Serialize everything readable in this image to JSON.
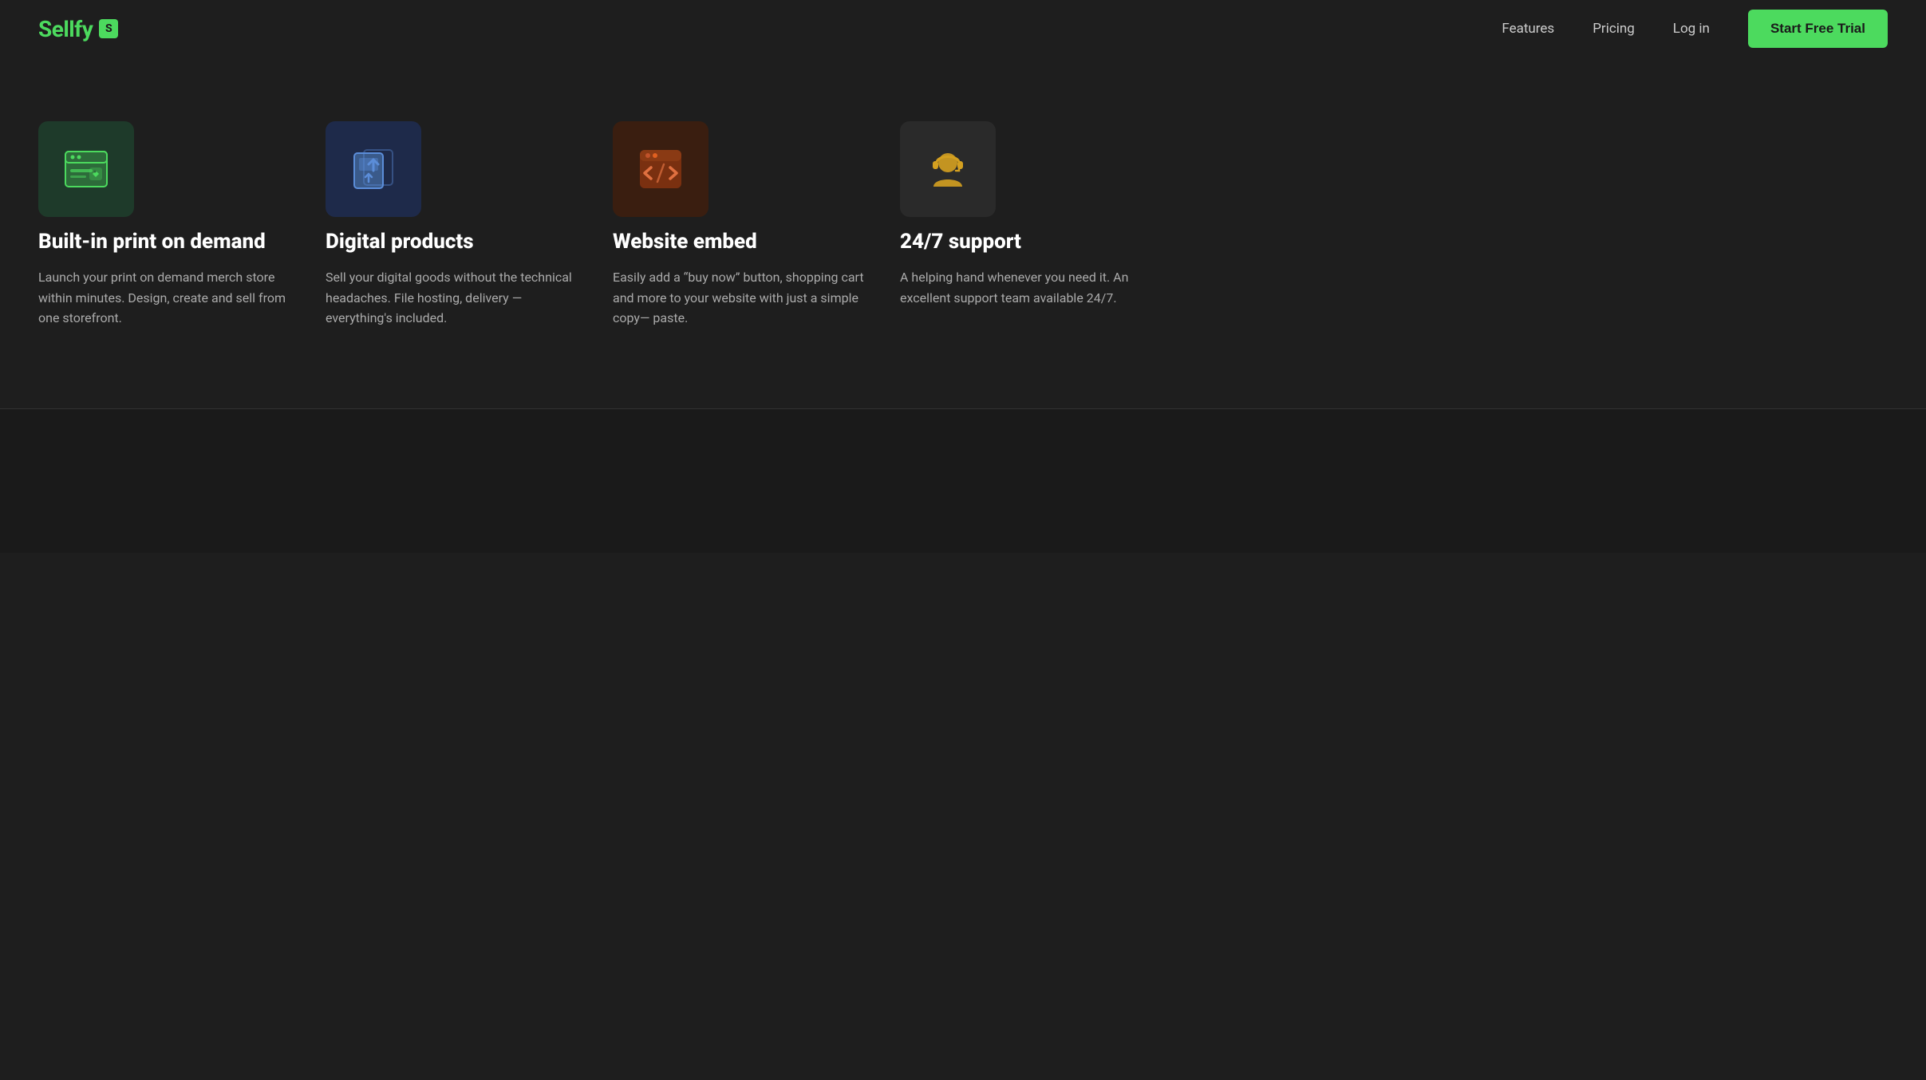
{
  "header": {
    "logo_text": "Sellfy",
    "logo_badge": "S",
    "nav": {
      "features_label": "Features",
      "pricing_label": "Pricing",
      "login_label": "Log in",
      "trial_label": "Start Free Trial"
    }
  },
  "features": [
    {
      "id": "print-on-demand",
      "title": "Built-in print on demand",
      "description": "Launch your print on demand merch store within minutes. Design, create and sell from one storefront.",
      "icon_name": "storefront-icon",
      "icon_color": "green"
    },
    {
      "id": "digital-products",
      "title": "Digital products",
      "description": "Sell your digital goods without the technical headaches. File hosting, delivery — everything's included.",
      "icon_name": "upload-icon",
      "icon_color": "blue"
    },
    {
      "id": "website-embed",
      "title": "Website embed",
      "description": "Easily add a “buy now” button, shopping cart and more to your website with just a simple copy— paste.",
      "icon_name": "code-icon",
      "icon_color": "orange"
    },
    {
      "id": "support",
      "title": "24/7 support",
      "description": "A helping hand whenever you need it. An excellent support team available 24/7.",
      "icon_name": "headset-icon",
      "icon_color": "dark"
    }
  ]
}
